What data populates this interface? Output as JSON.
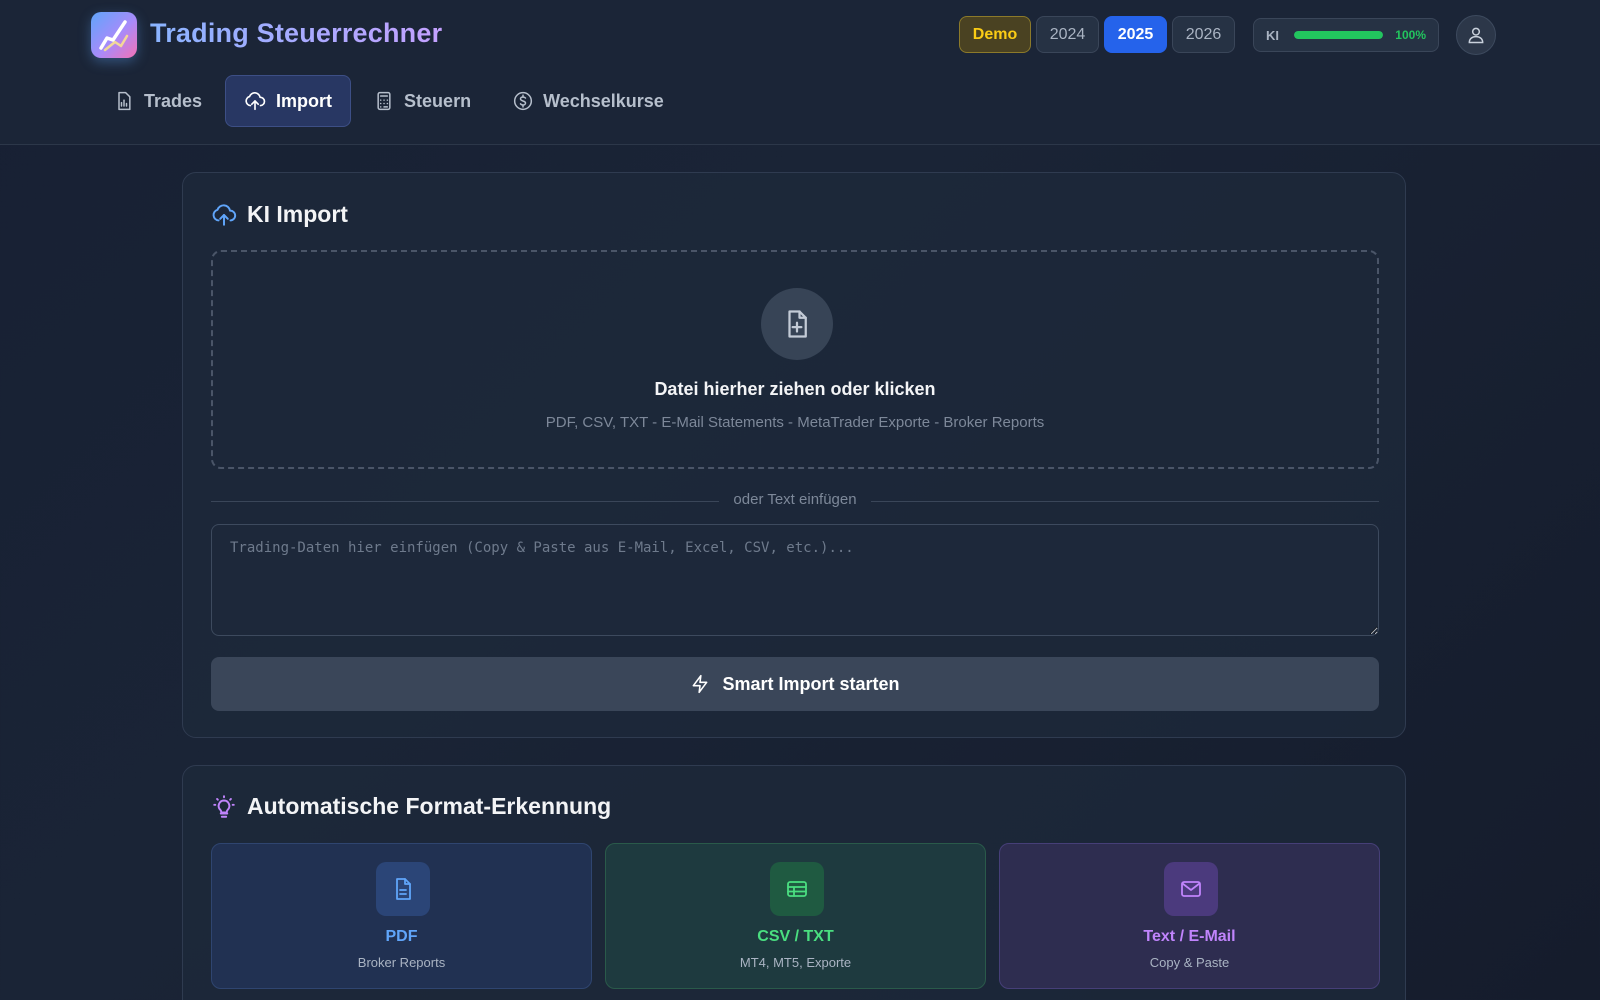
{
  "header": {
    "app_title": "Trading Steuerrechner",
    "demo_label": "Demo",
    "years": [
      "2024",
      "2025",
      "2026"
    ],
    "active_year": "2025",
    "ki": {
      "label": "KI",
      "level_percent": 100,
      "value_text": "100%"
    }
  },
  "nav": {
    "tabs": [
      {
        "label": "Trades",
        "icon": "chart-file-icon"
      },
      {
        "label": "Import",
        "icon": "cloud-upload-icon",
        "active": true
      },
      {
        "label": "Steuern",
        "icon": "calculator-icon"
      },
      {
        "label": "Wechselkurse",
        "icon": "dollar-circle-icon"
      }
    ]
  },
  "import_card": {
    "title": "KI Import",
    "dropzone_title": "Datei hierher ziehen oder klicken",
    "dropzone_sub": "PDF, CSV, TXT - E-Mail Statements - MetaTrader Exporte - Broker Reports",
    "divider_text": "oder Text einfügen",
    "paste_placeholder": "Trading-Daten hier einfügen (Copy & Paste aus E-Mail, Excel, CSV, etc.)...",
    "paste_value": "",
    "button_label": "Smart Import starten"
  },
  "format_card": {
    "title": "Automatische Format-Erkennung",
    "formats": [
      {
        "title": "PDF",
        "subtitle": "Broker Reports",
        "icon": "document-icon",
        "color": "#60a5fa"
      },
      {
        "title": "CSV / TXT",
        "subtitle": "MT4, MT5, Exporte",
        "icon": "table-icon",
        "color": "#4ade80"
      },
      {
        "title": "Text / E-Mail",
        "subtitle": "Copy & Paste",
        "icon": "mail-icon",
        "color": "#c084fc"
      }
    ]
  },
  "colors": {
    "accent": "#2563eb",
    "success": "#22c55e",
    "demo": "#facc15"
  }
}
